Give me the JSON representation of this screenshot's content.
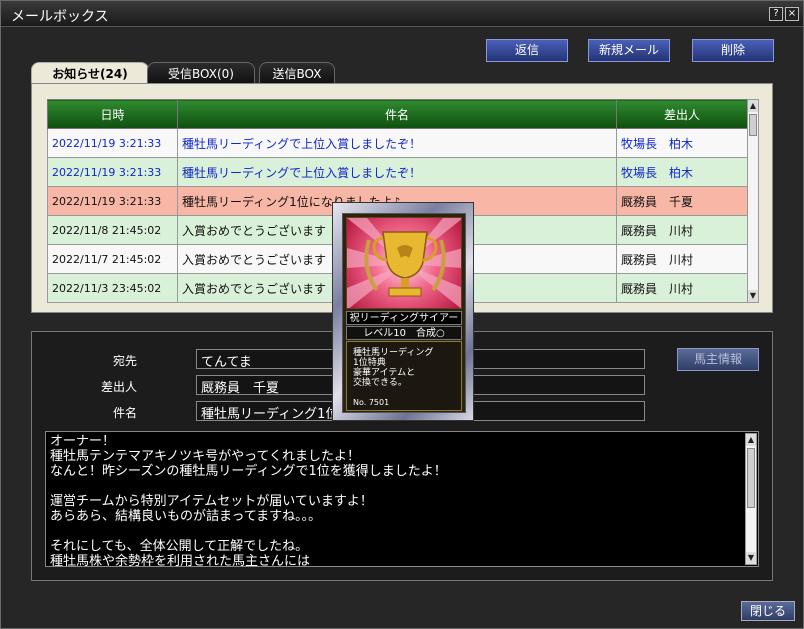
{
  "window": {
    "title": "メールボックス",
    "help_label": "?",
    "close_label": "×"
  },
  "actions": {
    "reply": "返信",
    "new_mail": "新規メール",
    "delete": "削除"
  },
  "tabs": [
    {
      "label": "お知らせ(24)",
      "active": true
    },
    {
      "label": "受信BOX(0)",
      "active": false
    },
    {
      "label": "送信BOX",
      "active": false
    }
  ],
  "table": {
    "headers": {
      "date": "日時",
      "subject": "件名",
      "sender": "差出人"
    },
    "rows": [
      {
        "date": "2022/11/19 3:21:33",
        "subject": "種牡馬リーディングで上位入賞しましたぞ！",
        "sender": "牧場長　柏木",
        "style": "white",
        "unread": true
      },
      {
        "date": "2022/11/19 3:21:33",
        "subject": "種牡馬リーディングで上位入賞しましたぞ！",
        "sender": "牧場長　柏木",
        "style": "green",
        "unread": true
      },
      {
        "date": "2022/11/19 3:21:33",
        "subject": "種牡馬リーディング1位になりましたよ♪",
        "sender": "厩務員　千夏",
        "style": "selected",
        "unread": false
      },
      {
        "date": "2022/11/8 21:45:02",
        "subject": "入賞おめでとうございます",
        "sender": "厩務員　川村",
        "style": "green",
        "unread": false
      },
      {
        "date": "2022/11/7 21:45:02",
        "subject": "入賞おめでとうございます",
        "sender": "厩務員　川村",
        "style": "white",
        "unread": false
      },
      {
        "date": "2022/11/3 23:45:02",
        "subject": "入賞おめでとうございます",
        "sender": "厩務員　川村",
        "style": "green",
        "unread": false
      }
    ]
  },
  "detail": {
    "to_label": "宛先",
    "to_value": "てんてま",
    "from_label": "差出人",
    "from_value": "厩務員　千夏",
    "subject_label": "件名",
    "subject_value": "種牡馬リーディング1位になりましたよ♪",
    "owner_info_button": "馬主情報"
  },
  "body_lines": [
    "オーナー！",
    "種牡馬テンテマアキノツキ号がやってくれましたよ！",
    "なんと！昨シーズンの種牡馬リーディングで1位を獲得しましたよ！",
    "",
    "運営チームから特別アイテムセットが届いていますよ！",
    "あらあら、結構良いものが詰まってますね。。。",
    "",
    "それにしても、全体公開して正解でしたね。",
    "種牡馬株や余勢枠を利用された馬主さんには"
  ],
  "card": {
    "name": "祝リーディングサイアー",
    "level": "レベル10　合成○",
    "desc_lines": [
      "種牡馬リーディング",
      "1位特典",
      "豪華アイテムと",
      "交換できる。"
    ],
    "number": "No. 7501",
    "icon": "trophy-icon"
  },
  "close_button": "閉じる",
  "colors": {
    "header_green": "#1f6f1f",
    "button_blue": "#3a4ea0",
    "selected_row": "#f8b6a6",
    "unread_text": "#1026d0"
  }
}
